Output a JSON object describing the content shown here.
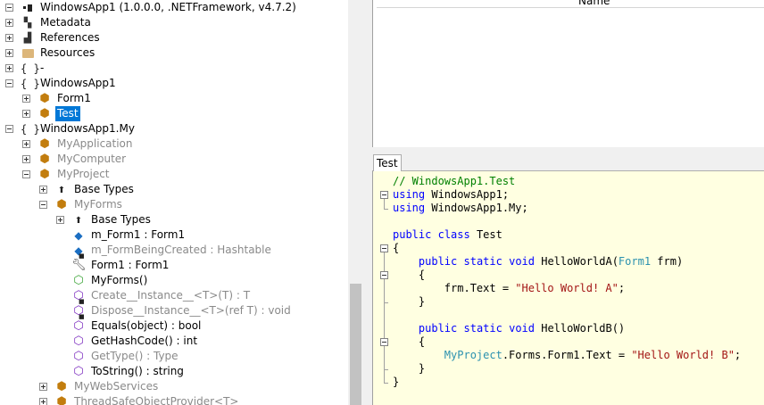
{
  "tree": {
    "items": [
      {
        "label": "WindowsApp1 (1.0.0.0, .NETFramework, v4.7.2)",
        "icon": "assembly-icon",
        "level": 0,
        "expander": "minus",
        "style": "normal"
      },
      {
        "label": "Metadata",
        "icon": "metadata-icon",
        "level": 0,
        "expander": "plus",
        "style": "normal"
      },
      {
        "label": "References",
        "icon": "references-icon",
        "level": 0,
        "expander": "plus",
        "style": "normal"
      },
      {
        "label": "Resources",
        "icon": "folder-icon",
        "level": 0,
        "expander": "plus",
        "style": "normal"
      },
      {
        "label": "-",
        "icon": "namespace-icon",
        "level": 0,
        "expander": "plus",
        "style": "normal"
      },
      {
        "label": "WindowsApp1",
        "icon": "namespace-icon",
        "level": 0,
        "expander": "minus",
        "style": "normal"
      },
      {
        "label": "Form1",
        "icon": "class-icon",
        "level": 1,
        "expander": "plus",
        "style": "normal"
      },
      {
        "label": "Test",
        "icon": "class-icon",
        "level": 1,
        "expander": "plus",
        "style": "selected"
      },
      {
        "label": "WindowsApp1.My",
        "icon": "namespace-icon",
        "level": 0,
        "expander": "minus",
        "style": "normal"
      },
      {
        "label": "MyApplication",
        "icon": "class-icon",
        "level": 1,
        "expander": "plus",
        "style": "gray"
      },
      {
        "label": "MyComputer",
        "icon": "class-icon",
        "level": 1,
        "expander": "plus",
        "style": "gray"
      },
      {
        "label": "MyProject",
        "icon": "class-icon",
        "level": 1,
        "expander": "minus",
        "style": "gray"
      },
      {
        "label": "Base Types",
        "icon": "base-types-icon",
        "level": 2,
        "expander": "plus",
        "style": "normal"
      },
      {
        "label": "MyForms",
        "icon": "class-icon",
        "level": 2,
        "expander": "minus",
        "style": "gray"
      },
      {
        "label": "Base Types",
        "icon": "base-types-icon",
        "level": 3,
        "expander": "plus",
        "style": "normal"
      },
      {
        "label": "m_Form1 : Form1",
        "icon": "field-icon",
        "level": 3,
        "expander": "none",
        "style": "normal"
      },
      {
        "label": "m_FormBeingCreated : Hashtable",
        "icon": "private-field-icon",
        "level": 3,
        "expander": "none",
        "style": "gray"
      },
      {
        "label": "Form1 : Form1",
        "icon": "property-icon",
        "level": 3,
        "expander": "none",
        "style": "normal"
      },
      {
        "label": "MyForms()",
        "icon": "constructor-icon",
        "level": 3,
        "expander": "none",
        "style": "normal"
      },
      {
        "label": "Create__Instance__<T>(T) : T",
        "icon": "private-method-icon",
        "level": 3,
        "expander": "none",
        "style": "gray"
      },
      {
        "label": "Dispose__Instance__<T>(ref T) : void",
        "icon": "private-method-icon",
        "level": 3,
        "expander": "none",
        "style": "gray"
      },
      {
        "label": "Equals(object) : bool",
        "icon": "method-icon",
        "level": 3,
        "expander": "none",
        "style": "normal"
      },
      {
        "label": "GetHashCode() : int",
        "icon": "method-icon",
        "level": 3,
        "expander": "none",
        "style": "normal"
      },
      {
        "label": "GetType() : Type",
        "icon": "method-icon",
        "level": 3,
        "expander": "none",
        "style": "gray"
      },
      {
        "label": "ToString() : string",
        "icon": "method-icon",
        "level": 3,
        "expander": "none",
        "style": "normal"
      },
      {
        "label": "MyWebServices",
        "icon": "class-icon",
        "level": 2,
        "expander": "plus",
        "style": "gray"
      },
      {
        "label": "ThreadSafeObjectProvider<T>",
        "icon": "class-icon",
        "level": 2,
        "expander": "plus",
        "style": "gray"
      }
    ]
  },
  "grid": {
    "column_header": "Name"
  },
  "editor": {
    "tab_label": "Test",
    "lines": [
      [
        {
          "t": "// WindowsApp1.Test",
          "c": "cm"
        }
      ],
      [
        {
          "t": "using",
          "c": "kw"
        },
        {
          "t": " WindowsApp1;",
          "c": ""
        }
      ],
      [
        {
          "t": "using",
          "c": "kw"
        },
        {
          "t": " WindowsApp1.My;",
          "c": ""
        }
      ],
      [],
      [
        {
          "t": "public",
          "c": "kw"
        },
        {
          "t": " ",
          "c": ""
        },
        {
          "t": "class",
          "c": "kw"
        },
        {
          "t": " Test",
          "c": ""
        }
      ],
      [
        {
          "t": "{",
          "c": ""
        }
      ],
      [
        {
          "t": "    ",
          "c": ""
        },
        {
          "t": "public",
          "c": "kw"
        },
        {
          "t": " ",
          "c": ""
        },
        {
          "t": "static",
          "c": "kw"
        },
        {
          "t": " ",
          "c": ""
        },
        {
          "t": "void",
          "c": "kw"
        },
        {
          "t": " HelloWorldA(",
          "c": ""
        },
        {
          "t": "Form1",
          "c": "tp"
        },
        {
          "t": " frm)",
          "c": ""
        }
      ],
      [
        {
          "t": "    {",
          "c": ""
        }
      ],
      [
        {
          "t": "        frm.Text = ",
          "c": ""
        },
        {
          "t": "\"Hello World! A\"",
          "c": "st"
        },
        {
          "t": ";",
          "c": ""
        }
      ],
      [
        {
          "t": "    }",
          "c": ""
        }
      ],
      [],
      [
        {
          "t": "    ",
          "c": ""
        },
        {
          "t": "public",
          "c": "kw"
        },
        {
          "t": " ",
          "c": ""
        },
        {
          "t": "static",
          "c": "kw"
        },
        {
          "t": " ",
          "c": ""
        },
        {
          "t": "void",
          "c": "kw"
        },
        {
          "t": " HelloWorldB()",
          "c": ""
        }
      ],
      [
        {
          "t": "    {",
          "c": ""
        }
      ],
      [
        {
          "t": "        ",
          "c": ""
        },
        {
          "t": "MyProject",
          "c": "tp"
        },
        {
          "t": ".Forms.Form1.Text = ",
          "c": ""
        },
        {
          "t": "\"Hello World! B\"",
          "c": "st"
        },
        {
          "t": ";",
          "c": ""
        }
      ],
      [
        {
          "t": "    }",
          "c": ""
        }
      ],
      [
        {
          "t": "}",
          "c": ""
        }
      ]
    ]
  },
  "colors": {
    "selection": "#0078d7",
    "editor_background": "#ffffe1",
    "keyword": "#0000ff",
    "comment": "#008000",
    "string": "#a31515",
    "type": "#2b91af"
  }
}
